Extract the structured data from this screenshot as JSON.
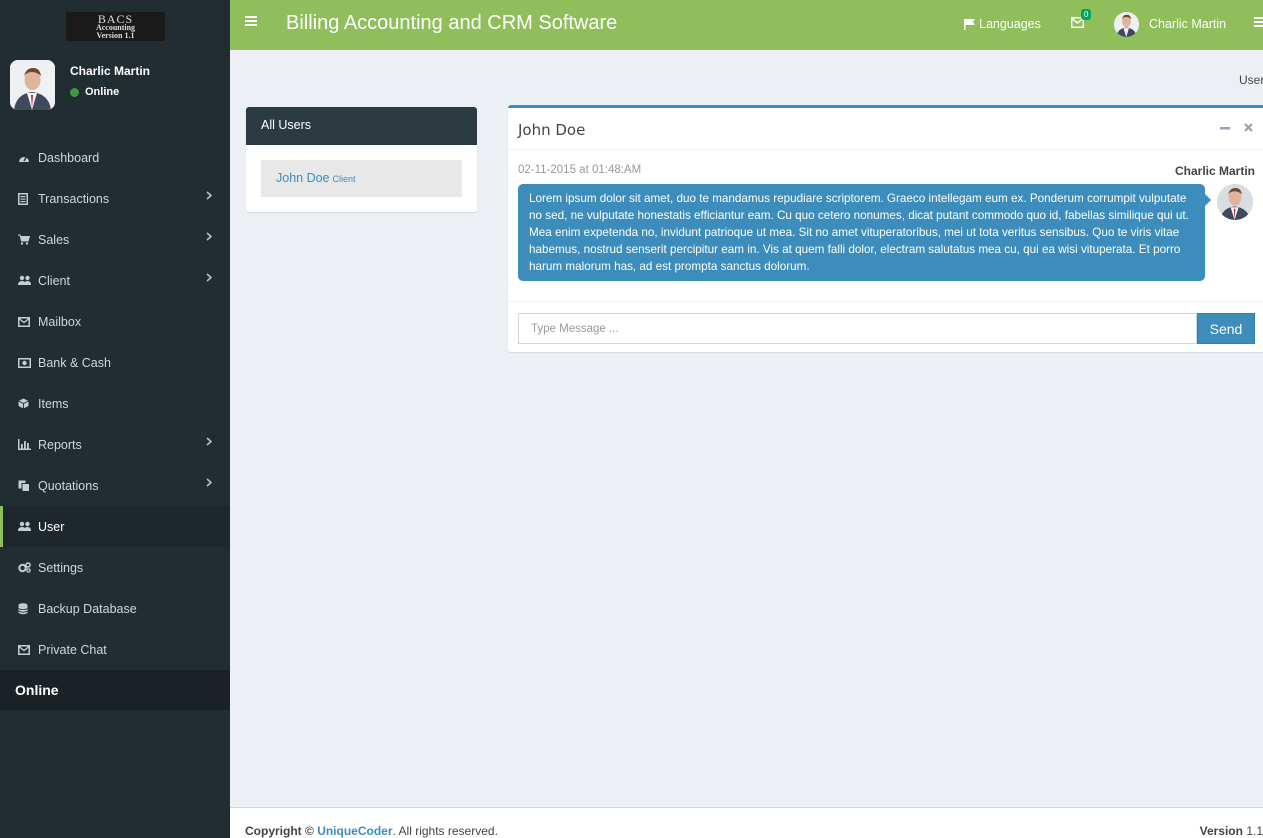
{
  "logo": {
    "line1": "BACS",
    "line2": "Accounting",
    "line3": "Version 1.1"
  },
  "user_panel": {
    "name": "Charlic Martin",
    "status": "Online"
  },
  "menu": [
    {
      "label": "Dashboard",
      "icon": "dashboard-icon",
      "has_children": false
    },
    {
      "label": "Transactions",
      "icon": "file-icon",
      "has_children": true
    },
    {
      "label": "Sales",
      "icon": "cart-icon",
      "has_children": true
    },
    {
      "label": "Client",
      "icon": "users-icon",
      "has_children": true
    },
    {
      "label": "Mailbox",
      "icon": "envelope-icon",
      "has_children": false
    },
    {
      "label": "Bank & Cash",
      "icon": "money-icon",
      "has_children": false
    },
    {
      "label": "Items",
      "icon": "cube-icon",
      "has_children": false
    },
    {
      "label": "Reports",
      "icon": "bar-chart-icon",
      "has_children": true
    },
    {
      "label": "Quotations",
      "icon": "copy-icon",
      "has_children": true
    },
    {
      "label": "User",
      "icon": "users-icon",
      "has_children": false,
      "active": true
    },
    {
      "label": "Settings",
      "icon": "gears-icon",
      "has_children": false
    },
    {
      "label": "Backup Database",
      "icon": "database-icon",
      "has_children": false
    },
    {
      "label": "Private Chat",
      "icon": "envelope-icon",
      "has_children": false
    }
  ],
  "sidebar_online": "Online",
  "header": {
    "title": "Billing Accounting and CRM Software",
    "languages": "Languages",
    "mail_badge": "0",
    "user": "Charlic Martin"
  },
  "breadcrumb": "User",
  "users_box": {
    "title": "All Users",
    "entry_name": "John Doe",
    "entry_tag": "Client"
  },
  "chat": {
    "title": "John Doe",
    "message_time": "02-11-2015 at 01:48:AM",
    "message_user": "Charlic Martin",
    "message_text": "Lorem ipsum dolor sit amet, duo te mandamus repudiare scriptorem. Graeco intellegam eum ex. Ponderum corrumpit vulputate no sed, ne vulputate honestatis efficiantur eam. Cu quo cetero nonumes, dicat putant commodo quo id, fabellas similique qui ut. Mea enim expetenda no, invidunt patrioque ut mea. Sit no amet vituperatoribus, mei ut tota veritus sensibus. Quo te viris vitae habemus, nostrud senserit percipitur eam in. Vis at quem falli dolor, electram salutatus mea cu, qui ea wisi vituperata. Et porro harum malorum has, ad est prompta sanctus dolorum.",
    "input_placeholder": "Type Message ...",
    "send_label": "Send"
  },
  "footer": {
    "copyright_prefix": "Copyright ©",
    "brand": "UniqueCoder",
    "suffix": ". All rights reserved.",
    "version_label": "Version",
    "version": "1.1"
  },
  "colors": {
    "header": "#8fbe5a",
    "sidebar": "#222d32",
    "accent": "#3c8dbc"
  }
}
